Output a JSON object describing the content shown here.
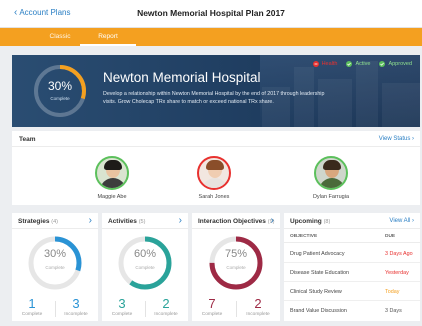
{
  "nav": {
    "back_label": "Account Plans",
    "title": "Newton Memorial Hospital Plan 2017"
  },
  "tabs": [
    {
      "label": "Classic",
      "active": false
    },
    {
      "label": "Report",
      "active": true
    }
  ],
  "hero": {
    "percent": "30%",
    "percent_label": "Complete",
    "title": "Newton Memorial Hospital",
    "description": "Develop a relationship within Newton Memorial Hospital by the end of 2017 through leadership visits. Grow Cholecap TRx share to match or exceed national TRx share.",
    "statuses": [
      {
        "label": "Health",
        "color": "#e8312f",
        "icon": "alert-icon"
      },
      {
        "label": "Active",
        "color": "#5cc05c",
        "icon": "check-circle-icon"
      },
      {
        "label": "Approved",
        "color": "#5cc05c",
        "icon": "check-circle-icon"
      }
    ]
  },
  "team": {
    "title": "Team",
    "view_status": "View Status",
    "members": [
      {
        "name": "Maggie Abe",
        "ring_color": "#5cc05c"
      },
      {
        "name": "Sarah Jones",
        "ring_color": "#e8312f"
      },
      {
        "name": "Dylan Farrugia",
        "ring_color": "#5cc05c"
      }
    ]
  },
  "cards": {
    "strategies": {
      "title": "Strategies",
      "count": "(4)",
      "percent": "30%",
      "percent_label": "Complete",
      "complete": "1",
      "complete_label": "Complete",
      "incomplete": "3",
      "incomplete_label": "Incomplete",
      "color": "#2a93d5",
      "progress": 0.3
    },
    "activities": {
      "title": "Activities",
      "count": "(5)",
      "percent": "60%",
      "percent_label": "Complete",
      "complete": "3",
      "complete_label": "Complete",
      "incomplete": "2",
      "incomplete_label": "Incomplete",
      "color": "#2aa39a",
      "progress": 0.6
    },
    "objectives": {
      "title": "Interaction Objectives",
      "count": "(9)",
      "percent": "75%",
      "percent_label": "Complete",
      "complete": "7",
      "complete_label": "Complete",
      "incomplete": "2",
      "incomplete_label": "Incomplete",
      "color": "#9e2a45",
      "progress": 0.75
    }
  },
  "upcoming": {
    "title": "Upcoming",
    "count": "(8)",
    "view_all": "View All",
    "col_objective": "OBJECTIVE",
    "col_due": "DUE",
    "rows": [
      {
        "objective": "Drug Patient Advocacy",
        "due": "3 Days Ago",
        "due_color": "#e8312f"
      },
      {
        "objective": "Disease State Education",
        "due": "Yesterday",
        "due_color": "#e8312f"
      },
      {
        "objective": "Clinical Study Review",
        "due": "Today",
        "due_color": "#f4a020"
      },
      {
        "objective": "Brand Value Discussion",
        "due": "3 Days",
        "due_color": "#555555"
      }
    ]
  },
  "colors": {
    "accent": "#f4a020",
    "link": "#2a7fc4",
    "hero_bg": "#1f3d60"
  }
}
